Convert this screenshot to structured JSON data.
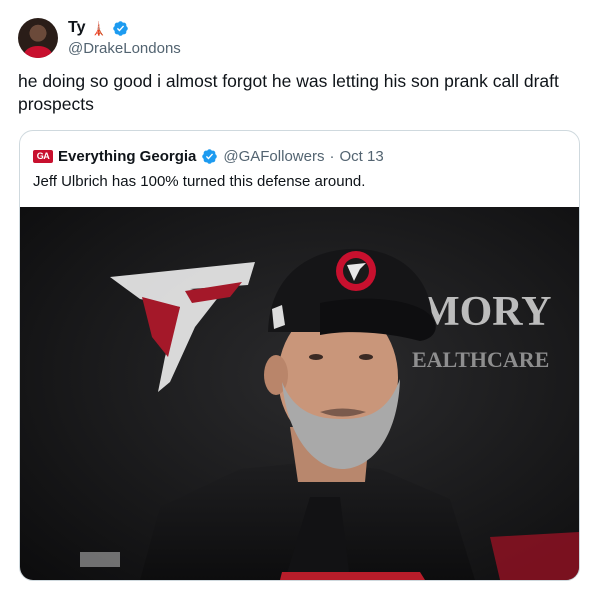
{
  "author": {
    "name": "Ty",
    "emoji": "🗼",
    "handle": "@DrakeLondons",
    "avatar_icon": "avatar-person-red-shirt"
  },
  "tweet": {
    "text": "he doing so good i almost forgot he was letting his son prank call draft prospects"
  },
  "quoted": {
    "logo_text": "GA",
    "name": "Everything Georgia",
    "handle": "@GAFollowers",
    "separator": "·",
    "date": "Oct 13",
    "text": "Jeff Ulbrich has 100% turned this defense around.",
    "photo": {
      "backdrop_text_line1": "MORY",
      "backdrop_text_line2": "EALTHCARE",
      "cap_logo": "falcons-logo",
      "background_logo": "falcons-logo"
    }
  },
  "colors": {
    "text_primary": "#0f1419",
    "text_secondary": "#536471",
    "verified_blue": "#1d9bf0",
    "border": "#cfd9de",
    "falcons_red": "#c8102e"
  }
}
